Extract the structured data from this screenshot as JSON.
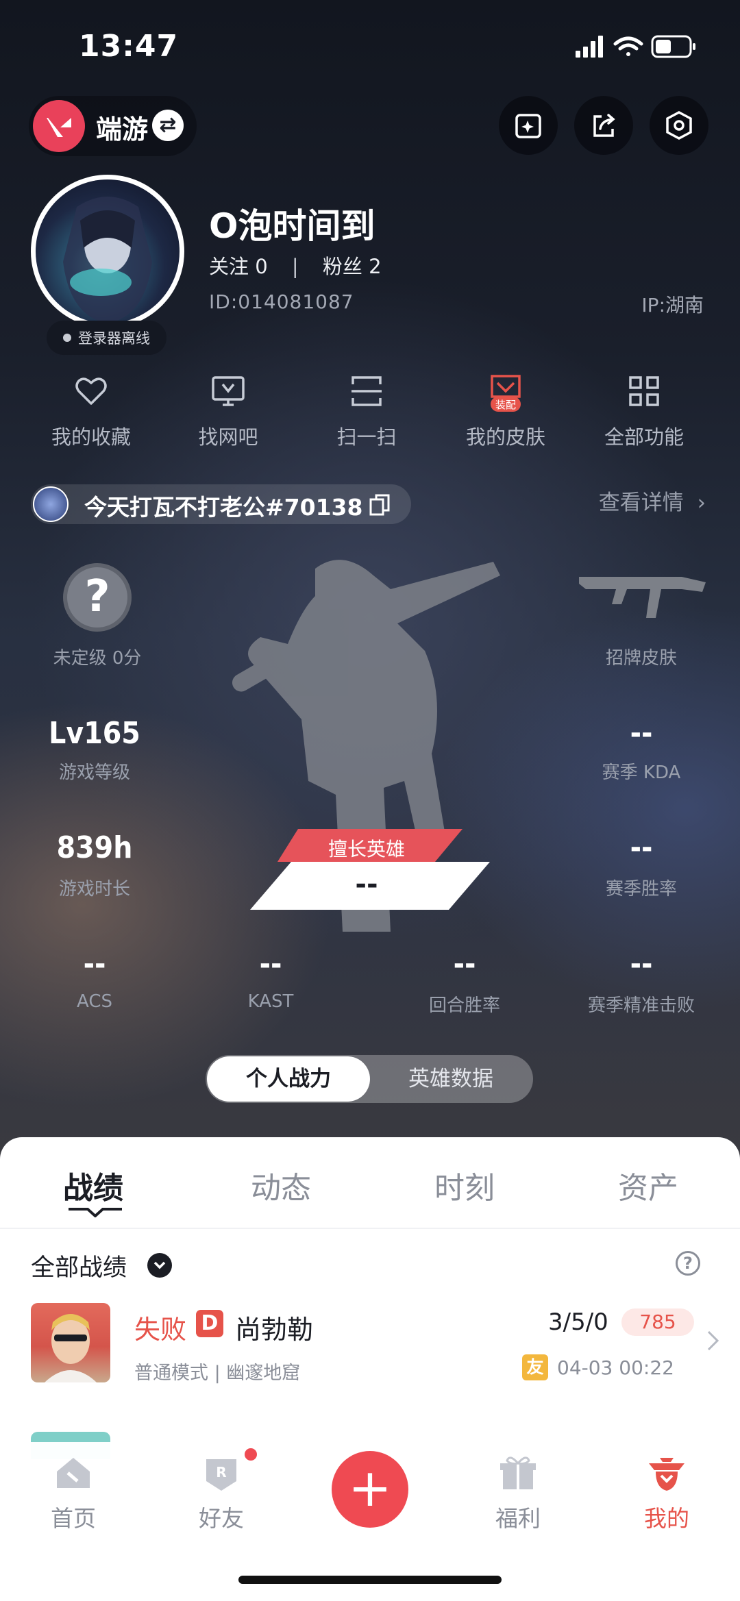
{
  "status_bar": {
    "time": "13:47"
  },
  "header": {
    "game_name": "端游"
  },
  "profile": {
    "status": "登录器离线",
    "username": "O泡时间到",
    "follow_label": "关注",
    "follow_count": "0",
    "fans_label": "粉丝",
    "fans_count": "2",
    "id": "ID:014081087",
    "ip": "IP:湖南"
  },
  "functions": [
    {
      "label": "我的收藏",
      "icon": "heart-icon"
    },
    {
      "label": "找网吧",
      "icon": "monitor-icon"
    },
    {
      "label": "扫一扫",
      "icon": "scan-icon"
    },
    {
      "label": "我的皮肤",
      "icon": "skin-icon",
      "badge": "装配"
    },
    {
      "label": "全部功能",
      "icon": "grid-icon"
    }
  ],
  "rank_bar": {
    "name": "今天打瓦不打老公#70138",
    "detail_link": "查看详情"
  },
  "stats": {
    "rank": "未定级 0分",
    "skin_label": "招牌皮肤",
    "level_value": "Lv165",
    "level_label": "游戏等级",
    "kda_value": "--",
    "kda_label": "赛季 KDA",
    "hours_value": "839h",
    "hours_label": "游戏时长",
    "winrate_value": "--",
    "winrate_label": "赛季胜率",
    "hero_banner_label": "擅长英雄",
    "hero_banner_value": "--",
    "acs_value": "--",
    "acs_label": "ACS",
    "kast_value": "--",
    "kast_label": "KAST",
    "round_value": "--",
    "round_label": "回合胜率",
    "precise_value": "--",
    "precise_label": "赛季精准击败"
  },
  "view_switch": {
    "active": "个人战力",
    "inactive": "英雄数据"
  },
  "sheet_tabs": [
    "战绩",
    "动态",
    "时刻",
    "资产"
  ],
  "records": {
    "filter": "全部战绩",
    "items": [
      {
        "result": "失败",
        "grade": "D",
        "hero": "尚勃勒",
        "kda": "3/5/0",
        "score": "785",
        "mode": "普通模式 | 幽邃地窟",
        "friend_badge": "友",
        "time": "04-03 00:22"
      }
    ]
  },
  "bottom_nav": [
    {
      "label": "首页"
    },
    {
      "label": "好友"
    },
    {
      "label": "福利"
    },
    {
      "label": "我的"
    }
  ],
  "colors": {
    "accent": "#e6534a",
    "brand": "#e9415a"
  }
}
